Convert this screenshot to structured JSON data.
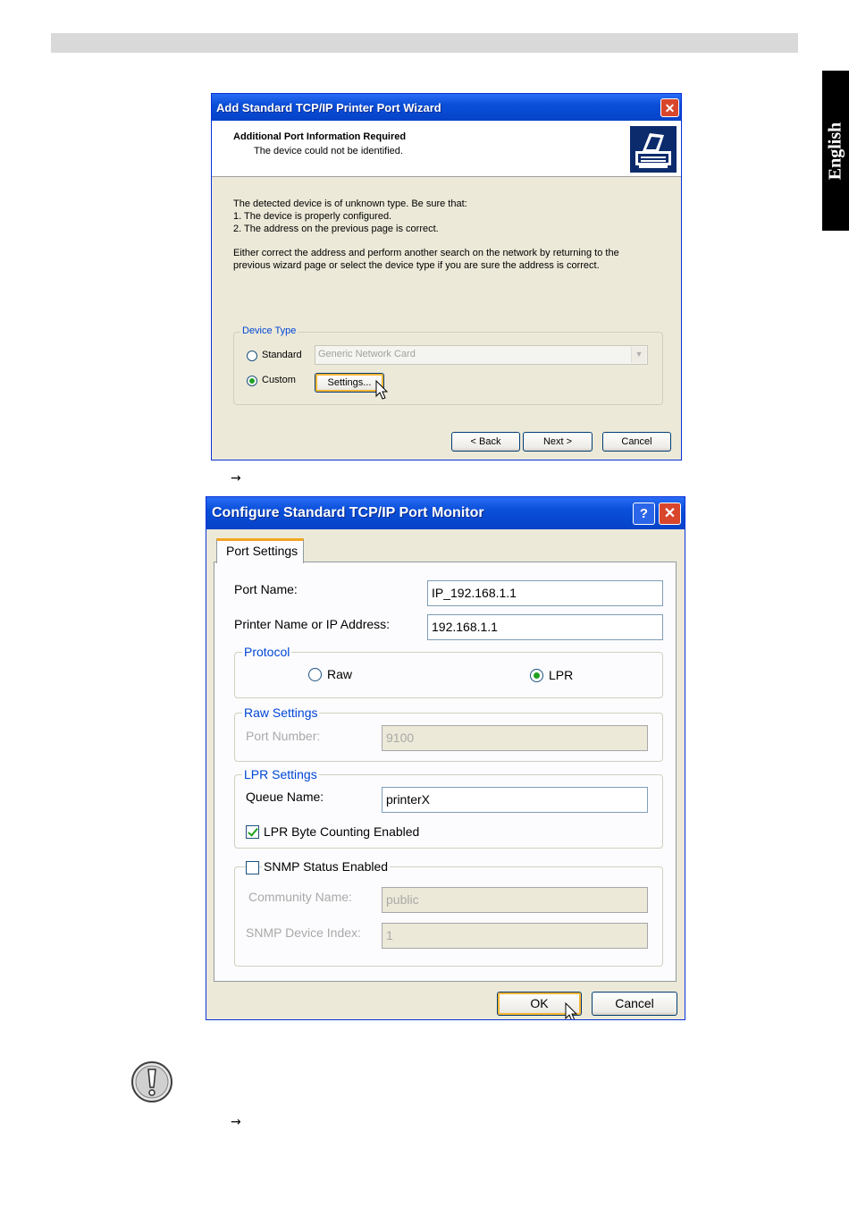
{
  "page": {
    "side_tab": "English",
    "arrow_1": "→",
    "arrow_2": "→"
  },
  "wizard": {
    "title": "Add Standard TCP/IP Printer Port Wizard",
    "header_title": "Additional Port Information Required",
    "header_subtitle": "The device could not be identified.",
    "body_line1": "The detected device is of unknown type.  Be sure that:",
    "body_line2": "1. The device is properly configured.",
    "body_line3": "2.  The address on the previous page is correct.",
    "body_line4": "Either correct the address and perform another search on the network by returning to the",
    "body_line5": "previous wizard page or select the device type if you are sure the address is correct.",
    "device_type_legend": "Device Type",
    "radio_standard": "Standard",
    "radio_custom": "Custom",
    "device_combo": "Generic Network Card",
    "settings_button": "Settings...",
    "back_button": "< Back",
    "next_button": "Next >",
    "cancel_button": "Cancel",
    "close_glyph": "✕",
    "selected_radio": "Custom"
  },
  "monitor": {
    "title": "Configure Standard TCP/IP Port Monitor",
    "help_glyph": "?",
    "close_glyph": "✕",
    "tab_label": "Port Settings",
    "port_name_label": "Port Name:",
    "port_name_value": "IP_192.168.1.1",
    "printer_name_label": "Printer Name or IP Address:",
    "printer_name_value": "192.168.1.1",
    "protocol_legend": "Protocol",
    "radio_raw": "Raw",
    "radio_lpr": "LPR",
    "selected_protocol": "LPR",
    "raw_settings_legend": "Raw Settings",
    "port_number_label": "Port Number:",
    "port_number_value": "9100",
    "lpr_settings_legend": "LPR Settings",
    "queue_name_label": "Queue Name:",
    "queue_name_value": "printerX",
    "lpr_byte_counting_label": "LPR Byte Counting Enabled",
    "lpr_byte_counting_checked": true,
    "snmp_label": "SNMP Status Enabled",
    "snmp_checked": false,
    "community_name_label": "Community Name:",
    "community_name_value": "public",
    "snmp_index_label": "SNMP Device Index:",
    "snmp_index_value": "1",
    "ok_button": "OK",
    "cancel_button": "Cancel"
  },
  "colors": {
    "titlebar": "#0a4fd9",
    "dialog_bg": "#ece9d8",
    "accent_label": "#0046d5",
    "close_red": "#d8462c"
  }
}
